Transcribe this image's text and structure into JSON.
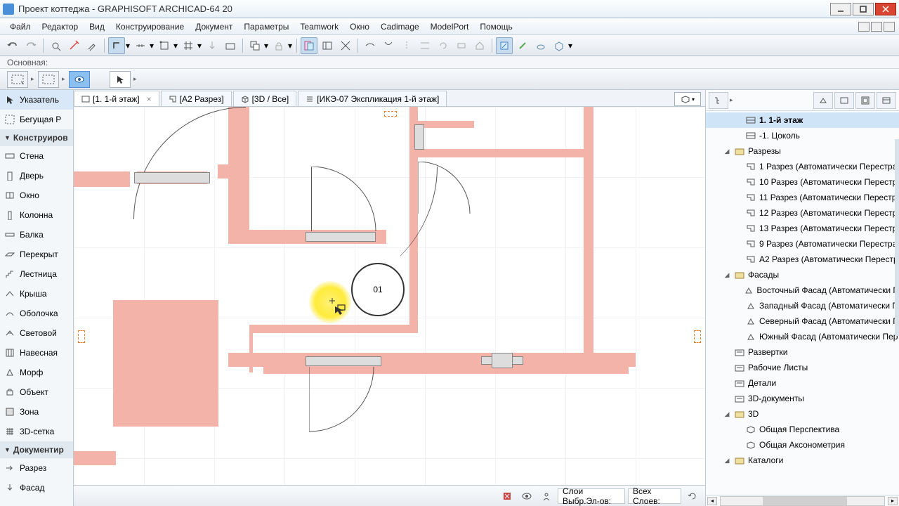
{
  "window": {
    "title": "Проект коттеджа - GRAPHISOFT ARCHICAD-64 20"
  },
  "menu": {
    "items": [
      "Файл",
      "Редактор",
      "Вид",
      "Конструирование",
      "Документ",
      "Параметры",
      "Teamwork",
      "Окно",
      "Cadimage",
      "ModelPort",
      "Помощь"
    ]
  },
  "subbar": {
    "label": "Основная:"
  },
  "tabs": {
    "items": [
      {
        "label": "[1. 1-й этаж]",
        "icon": "floor",
        "closable": true,
        "active": true
      },
      {
        "label": "[А2 Разрез]",
        "icon": "section",
        "closable": false
      },
      {
        "label": "[3D / Все]",
        "icon": "cube",
        "closable": false
      },
      {
        "label": "[ИКЭ-07 Экспликация 1-й этаж]",
        "icon": "list",
        "closable": false
      }
    ]
  },
  "toolbox": {
    "pointer": "Указатель",
    "marquee": "Бегущая Р",
    "group_construct": "Конструиров",
    "items_construct": [
      "Стена",
      "Дверь",
      "Окно",
      "Колонна",
      "Балка",
      "Перекрыт",
      "Лестница",
      "Крыша",
      "Оболочка",
      "Световой",
      "Навесная",
      "Морф",
      "Объект",
      "Зона",
      "3D-сетка"
    ],
    "group_document": "Документир",
    "items_document": [
      "Разрез",
      "Фасад"
    ]
  },
  "canvas": {
    "zone_label": "01"
  },
  "navigator": {
    "items": [
      {
        "label": "1. 1-й этаж",
        "icon": "floor",
        "depth": 2,
        "selected": true
      },
      {
        "label": "-1. Цоколь",
        "icon": "floor",
        "depth": 2
      },
      {
        "label": "Разрезы",
        "icon": "folder",
        "depth": 1,
        "expanded": true
      },
      {
        "label": "1 Разрез (Автоматически Перестра",
        "icon": "section",
        "depth": 2
      },
      {
        "label": "10 Разрез (Автоматически Перестр",
        "icon": "section",
        "depth": 2
      },
      {
        "label": "11 Разрез (Автоматически Перестр",
        "icon": "section",
        "depth": 2
      },
      {
        "label": "12 Разрез (Автоматически Перестр",
        "icon": "section",
        "depth": 2
      },
      {
        "label": "13 Разрез (Автоматически Перестр",
        "icon": "section",
        "depth": 2
      },
      {
        "label": "9 Разрез (Автоматически Перестра",
        "icon": "section",
        "depth": 2
      },
      {
        "label": "А2 Разрез (Автоматически Перестр",
        "icon": "section",
        "depth": 2
      },
      {
        "label": "Фасады",
        "icon": "folder",
        "depth": 1,
        "expanded": true
      },
      {
        "label": "Восточный Фасад (Автоматически П",
        "icon": "elev",
        "depth": 2
      },
      {
        "label": "Западный Фасад (Автоматически П",
        "icon": "elev",
        "depth": 2
      },
      {
        "label": "Северный Фасад (Автоматически П",
        "icon": "elev",
        "depth": 2
      },
      {
        "label": "Южный Фасад (Автоматически Пер",
        "icon": "elev",
        "depth": 2
      },
      {
        "label": "Развертки",
        "icon": "folder-doc",
        "depth": 1
      },
      {
        "label": "Рабочие Листы",
        "icon": "folder-doc",
        "depth": 1
      },
      {
        "label": "Детали",
        "icon": "folder-doc",
        "depth": 1
      },
      {
        "label": "3D-документы",
        "icon": "folder-doc",
        "depth": 1
      },
      {
        "label": "3D",
        "icon": "folder",
        "depth": 1,
        "expanded": true
      },
      {
        "label": "Общая Перспектива",
        "icon": "3d",
        "depth": 2
      },
      {
        "label": "Общая Аксонометрия",
        "icon": "3d",
        "depth": 2
      },
      {
        "label": "Каталоги",
        "icon": "folder",
        "depth": 1,
        "expanded": true
      }
    ]
  },
  "status": {
    "layer_label": "Слои Выбр.Эл-ов:",
    "all_layers": "Всех Слоев:"
  }
}
